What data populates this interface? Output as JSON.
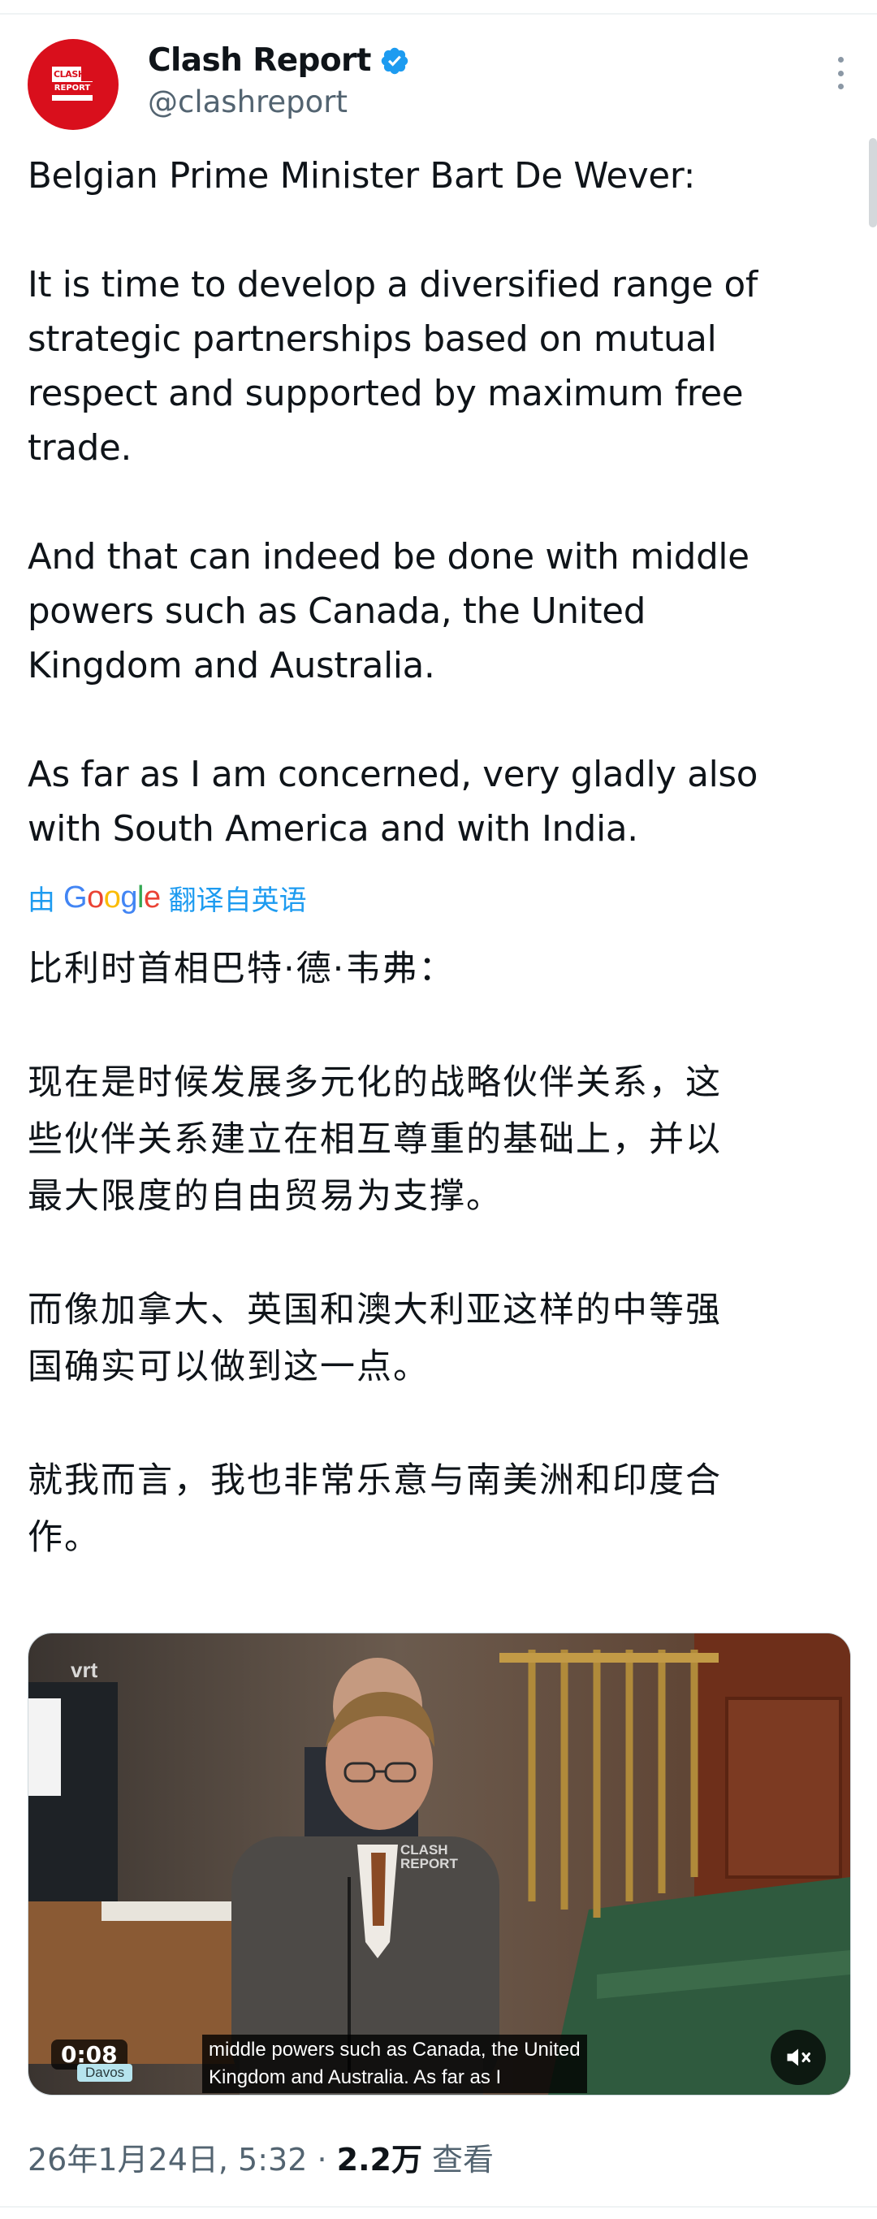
{
  "author": {
    "display_name": "Clash Report",
    "handle": "@clashreport",
    "verified": true,
    "avatar_text_line1": "CLASH",
    "avatar_text_line2": "REPORT",
    "avatar_color": "#d90f1c"
  },
  "tweet": {
    "paragraphs": [
      [
        "Belgian Prime Minister Bart De Wever:"
      ],
      [
        "It is time to develop a diversified range of",
        "strategic partnerships based on mutual",
        "respect and supported by maximum free",
        "trade."
      ],
      [
        "And that can indeed be done with middle",
        "powers such as Canada, the United",
        "Kingdom and Australia."
      ],
      [
        "As far as I am concerned, very gladly also",
        "with South America and with India."
      ]
    ]
  },
  "translation": {
    "prefix": "由",
    "provider": "Google",
    "suffix": "翻译自英语",
    "paragraphs": [
      [
        "比利时首相巴特·德·韦弗："
      ],
      [
        "现在是时候发展多元化的战略伙伴关系，这",
        "些伙伴关系建立在相互尊重的基础上，并以",
        "最大限度的自由贸易为支撑。"
      ],
      [
        "而像加拿大、英国和澳大利亚这样的中等强",
        "国确实可以做到这一点。"
      ],
      [
        "就我而言，我也非常乐意与南美洲和印度合",
        "作。"
      ]
    ]
  },
  "video": {
    "channel_logo": "vrt",
    "watermark_line1": "CLASH",
    "watermark_line2": "REPORT",
    "duration": "0:08",
    "location_tag": "Davos",
    "subtitle_line1": "middle powers such as Canada, the United",
    "subtitle_line2": "Kingdom and Australia.  As far as I",
    "mute_icon": "speaker-muted-icon"
  },
  "meta": {
    "date_time": "26年1月24日, 5:32 · ",
    "views_count": "2.2万",
    "views_label": " 查看"
  },
  "colors": {
    "link_blue": "#1d9bf0",
    "secondary_text": "#536471",
    "verified_blue": "#1d9bf0"
  }
}
